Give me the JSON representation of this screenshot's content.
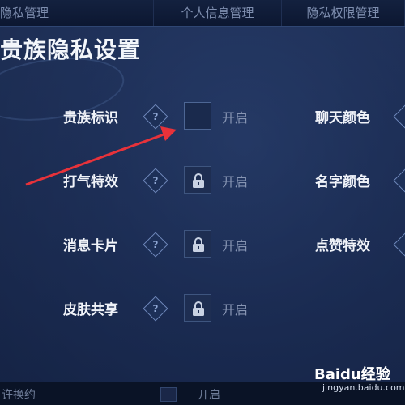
{
  "tabs": [
    "隐私管理",
    "个人信息管理",
    "隐私权限管理"
  ],
  "title": "贵族隐私设置",
  "left_rows": [
    {
      "label": "贵族标识",
      "status": "开启",
      "locked": false
    },
    {
      "label": "打气特效",
      "status": "开启",
      "locked": true
    },
    {
      "label": "消息卡片",
      "status": "开启",
      "locked": true
    },
    {
      "label": "皮肤共享",
      "status": "开启",
      "locked": true
    }
  ],
  "right_rows": [
    {
      "label": "聊天颜色"
    },
    {
      "label": "名字颜色"
    },
    {
      "label": "点赞特效"
    }
  ],
  "bottom": {
    "text": "许换约",
    "status": "开启"
  },
  "watermark": {
    "brand": "Baidu经验",
    "url": "jingyan.baidu.com"
  },
  "colors": {
    "accent": "#e8323a",
    "background": "#16264a"
  },
  "icons": {
    "help": "help-diamond-icon",
    "lock": "lock-icon"
  }
}
